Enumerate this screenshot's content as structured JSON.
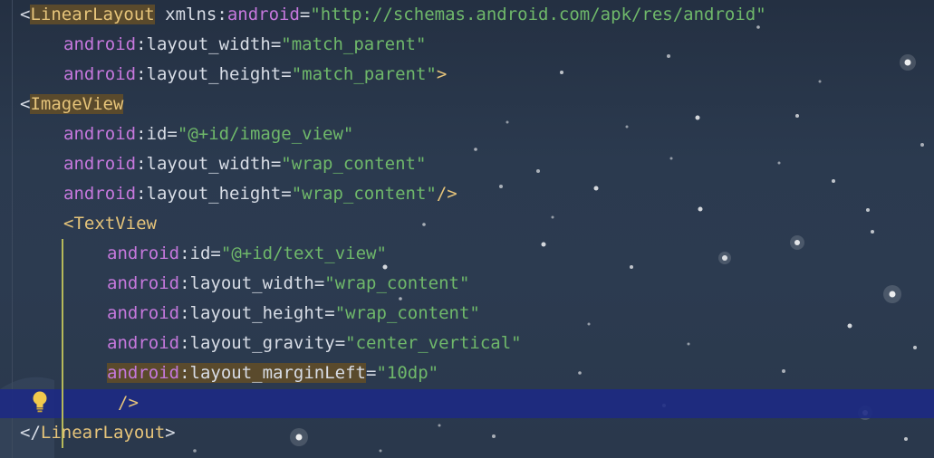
{
  "editor": {
    "theme_colors": {
      "background": "#2b3a4f",
      "tag": "#e6c47a",
      "namespace": "#c678dd",
      "string": "#6fb86a",
      "text": "#d8dde6",
      "caret_row": "#1d2a82",
      "scope_guide": "#b6b95a"
    },
    "lines": [
      {
        "tokens": [
          {
            "t": "<",
            "c": "tk-bracket"
          },
          {
            "t": "LinearLayout",
            "c": "tk-tag tk-tag-hl"
          },
          {
            "t": " xmlns",
            "c": "tk-attr"
          },
          {
            "t": ":",
            "c": "tk-colon"
          },
          {
            "t": "android",
            "c": "tk-ns"
          },
          {
            "t": "=",
            "c": "tk-eq"
          },
          {
            "t": "\"http://schemas.android.com/apk/res/android\"",
            "c": "tk-str"
          }
        ]
      },
      {
        "tokens": [
          {
            "t": "android",
            "c": "tk-ns"
          },
          {
            "t": ":",
            "c": "tk-colon"
          },
          {
            "t": "layout_width",
            "c": "tk-attr"
          },
          {
            "t": "=",
            "c": "tk-eq"
          },
          {
            "t": "\"match_parent\"",
            "c": "tk-str"
          }
        ]
      },
      {
        "tokens": [
          {
            "t": "android",
            "c": "tk-ns"
          },
          {
            "t": ":",
            "c": "tk-colon"
          },
          {
            "t": "layout_height",
            "c": "tk-attr"
          },
          {
            "t": "=",
            "c": "tk-eq"
          },
          {
            "t": "\"match_parent\"",
            "c": "tk-str"
          },
          {
            "t": ">",
            "c": "tk-end"
          }
        ]
      },
      {
        "tokens": [
          {
            "t": "<",
            "c": "tk-bracket"
          },
          {
            "t": "ImageView",
            "c": "tk-tag tk-tag-hl"
          }
        ]
      },
      {
        "tokens": [
          {
            "t": "android",
            "c": "tk-ns"
          },
          {
            "t": ":",
            "c": "tk-colon"
          },
          {
            "t": "id",
            "c": "tk-attr"
          },
          {
            "t": "=",
            "c": "tk-eq"
          },
          {
            "t": "\"@+id/image_view\"",
            "c": "tk-str"
          }
        ]
      },
      {
        "tokens": [
          {
            "t": "android",
            "c": "tk-ns"
          },
          {
            "t": ":",
            "c": "tk-colon"
          },
          {
            "t": "layout_width",
            "c": "tk-attr"
          },
          {
            "t": "=",
            "c": "tk-eq"
          },
          {
            "t": "\"wrap_content\"",
            "c": "tk-str"
          }
        ]
      },
      {
        "tokens": [
          {
            "t": "android",
            "c": "tk-ns"
          },
          {
            "t": ":",
            "c": "tk-colon"
          },
          {
            "t": "layout_height",
            "c": "tk-attr"
          },
          {
            "t": "=",
            "c": "tk-eq"
          },
          {
            "t": "\"wrap_content\"",
            "c": "tk-str"
          },
          {
            "t": "/>",
            "c": "tk-end"
          }
        ]
      },
      {
        "tokens": [
          {
            "t": "<",
            "c": "tk-end"
          },
          {
            "t": "TextView",
            "c": "tk-tag"
          }
        ]
      },
      {
        "tokens": [
          {
            "t": "android",
            "c": "tk-ns"
          },
          {
            "t": ":",
            "c": "tk-colon"
          },
          {
            "t": "id",
            "c": "tk-attr"
          },
          {
            "t": "=",
            "c": "tk-eq"
          },
          {
            "t": "\"@+id/text_view\"",
            "c": "tk-str"
          }
        ]
      },
      {
        "tokens": [
          {
            "t": "android",
            "c": "tk-ns"
          },
          {
            "t": ":",
            "c": "tk-colon"
          },
          {
            "t": "layout_width",
            "c": "tk-attr"
          },
          {
            "t": "=",
            "c": "tk-eq"
          },
          {
            "t": "\"wrap_content\"",
            "c": "tk-str"
          }
        ]
      },
      {
        "tokens": [
          {
            "t": "android",
            "c": "tk-ns"
          },
          {
            "t": ":",
            "c": "tk-colon"
          },
          {
            "t": "layout_height",
            "c": "tk-attr"
          },
          {
            "t": "=",
            "c": "tk-eq"
          },
          {
            "t": "\"wrap_content\"",
            "c": "tk-str"
          }
        ]
      },
      {
        "tokens": [
          {
            "t": "android",
            "c": "tk-ns"
          },
          {
            "t": ":",
            "c": "tk-colon"
          },
          {
            "t": "layout_gravity",
            "c": "tk-attr"
          },
          {
            "t": "=",
            "c": "tk-eq"
          },
          {
            "t": "\"center_vertical\"",
            "c": "tk-str"
          }
        ]
      },
      {
        "tokens": [
          {
            "t": "android",
            "c": "tk-ns tk-attr-hl"
          },
          {
            "t": ":",
            "c": "tk-colon tk-attr-hl"
          },
          {
            "t": "layout_marginLeft",
            "c": "tk-attr tk-attr-hl"
          },
          {
            "t": "=",
            "c": "tk-eq"
          },
          {
            "t": "\"10dp\"",
            "c": "tk-str"
          }
        ]
      },
      {
        "tokens": [
          {
            "t": "/>",
            "c": "tk-end"
          }
        ]
      },
      {
        "tokens": [
          {
            "t": "</",
            "c": "tk-bracket"
          },
          {
            "t": "LinearLayout",
            "c": "tk-tag"
          },
          {
            "t": ">",
            "c": "tk-bracket"
          }
        ]
      }
    ],
    "intention_icon": "lightbulb-icon"
  }
}
